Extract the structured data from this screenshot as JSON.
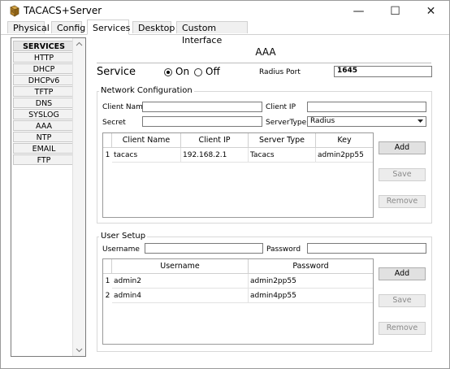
{
  "window": {
    "title": "TACACS+Server",
    "minimize_glyph": "—",
    "maximize_glyph": "☐",
    "close_glyph": "✕"
  },
  "tabs": [
    {
      "label": "Physical",
      "active": false
    },
    {
      "label": "Config",
      "active": false
    },
    {
      "label": "Services",
      "active": true
    },
    {
      "label": "Desktop",
      "active": false
    },
    {
      "label": "Custom Interface",
      "active": false
    }
  ],
  "services": {
    "header": "SERVICES",
    "items": [
      "HTTP",
      "DHCP",
      "DHCPv6",
      "TFTP",
      "DNS",
      "SYSLOG",
      "AAA",
      "NTP",
      "EMAIL",
      "FTP"
    ]
  },
  "aaa": {
    "title": "AAA",
    "service_label": "Service",
    "on_label": "On",
    "off_label": "Off",
    "service_state": "On",
    "radius_port_label": "Radius Port",
    "radius_port_value": "1645"
  },
  "network": {
    "group_title": "Network Configuration",
    "client_name_label": "Client Name",
    "client_name_value": "",
    "client_ip_label": "Client IP",
    "client_ip_value": "",
    "secret_label": "Secret",
    "secret_value": "",
    "server_type_label": "ServerType",
    "server_type_value": "Radius",
    "table": {
      "headers": [
        "Client Name",
        "Client IP",
        "Server Type",
        "Key"
      ],
      "rows": [
        {
          "num": "1",
          "client_name": "tacacs",
          "client_ip": "192.168.2.1",
          "server_type": "Tacacs",
          "key": "admin2pp55"
        }
      ]
    },
    "add_label": "Add",
    "save_label": "Save",
    "remove_label": "Remove"
  },
  "user": {
    "group_title": "User Setup",
    "username_label": "Username",
    "username_value": "",
    "password_label": "Password",
    "password_value": "",
    "table": {
      "headers": [
        "Username",
        "Password"
      ],
      "rows": [
        {
          "num": "1",
          "username": "admin2",
          "password": "admin2pp55"
        },
        {
          "num": "2",
          "username": "admin4",
          "password": "admin4pp55"
        }
      ]
    },
    "add_label": "Add",
    "save_label": "Save",
    "remove_label": "Remove"
  },
  "icons": {
    "app": "packet-tracer-server-icon",
    "scroll_up": "chevron-up-icon",
    "scroll_down": "chevron-down-icon",
    "dropdown": "chevron-down-icon"
  }
}
